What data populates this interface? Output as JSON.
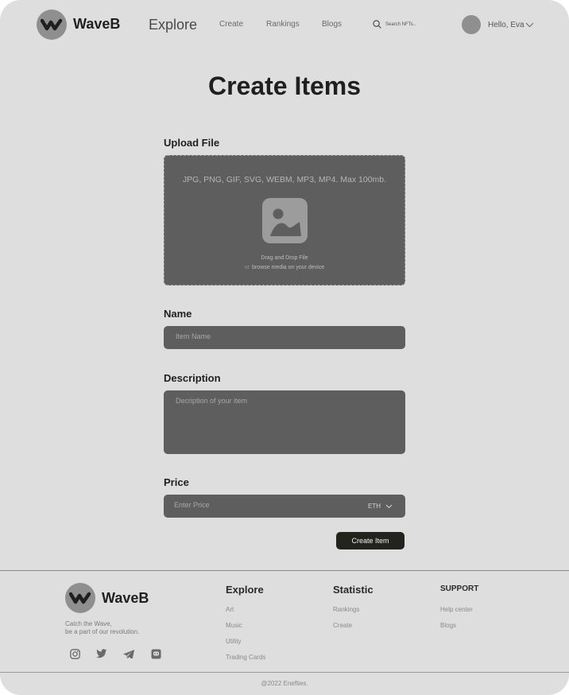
{
  "header": {
    "brand": "WaveB",
    "nav_explore": "Explore",
    "nav_links": [
      "Create",
      "Rankings",
      "Blogs"
    ],
    "search_placeholder": "Search NFTs..",
    "greeting": "Hello, Eva"
  },
  "page": {
    "title": "Create Items"
  },
  "form": {
    "upload_label": "Upload File",
    "upload_formats": "JPG, PNG, GIF, SVG, WEBM, MP3, MP4. Max 100mb.",
    "upload_drag": "Drag and Drop File",
    "upload_or": "or",
    "upload_browse": "browse media on your device",
    "name_label": "Name",
    "name_placeholder": "Item Name",
    "description_label": "Description",
    "description_placeholder": "Decription of your item",
    "price_label": "Price",
    "price_placeholder": "Enter Price",
    "currency": "ETH",
    "submit": "Create Item"
  },
  "footer": {
    "brand": "WaveB",
    "tagline_line1": "Catch the Wave,",
    "tagline_line2": "be a part of our revolution.",
    "columns": [
      {
        "heading": "Explore",
        "links": [
          "Art",
          "Music",
          "Utility",
          "Trading Cards"
        ]
      },
      {
        "heading": "Statistic",
        "links": [
          "Rankings",
          "Create"
        ]
      },
      {
        "heading": "SUPPORT",
        "links": [
          "Help center",
          "Blogs"
        ]
      }
    ],
    "social": [
      "instagram-icon",
      "twitter-icon",
      "telegram-icon",
      "discord-icon"
    ],
    "copyright": "@2022 Enefties."
  },
  "colors": {
    "background": "#dedede",
    "input_fill": "#5e5e5e",
    "button": "#23231e",
    "logo_circle": "#8f8f8f"
  }
}
